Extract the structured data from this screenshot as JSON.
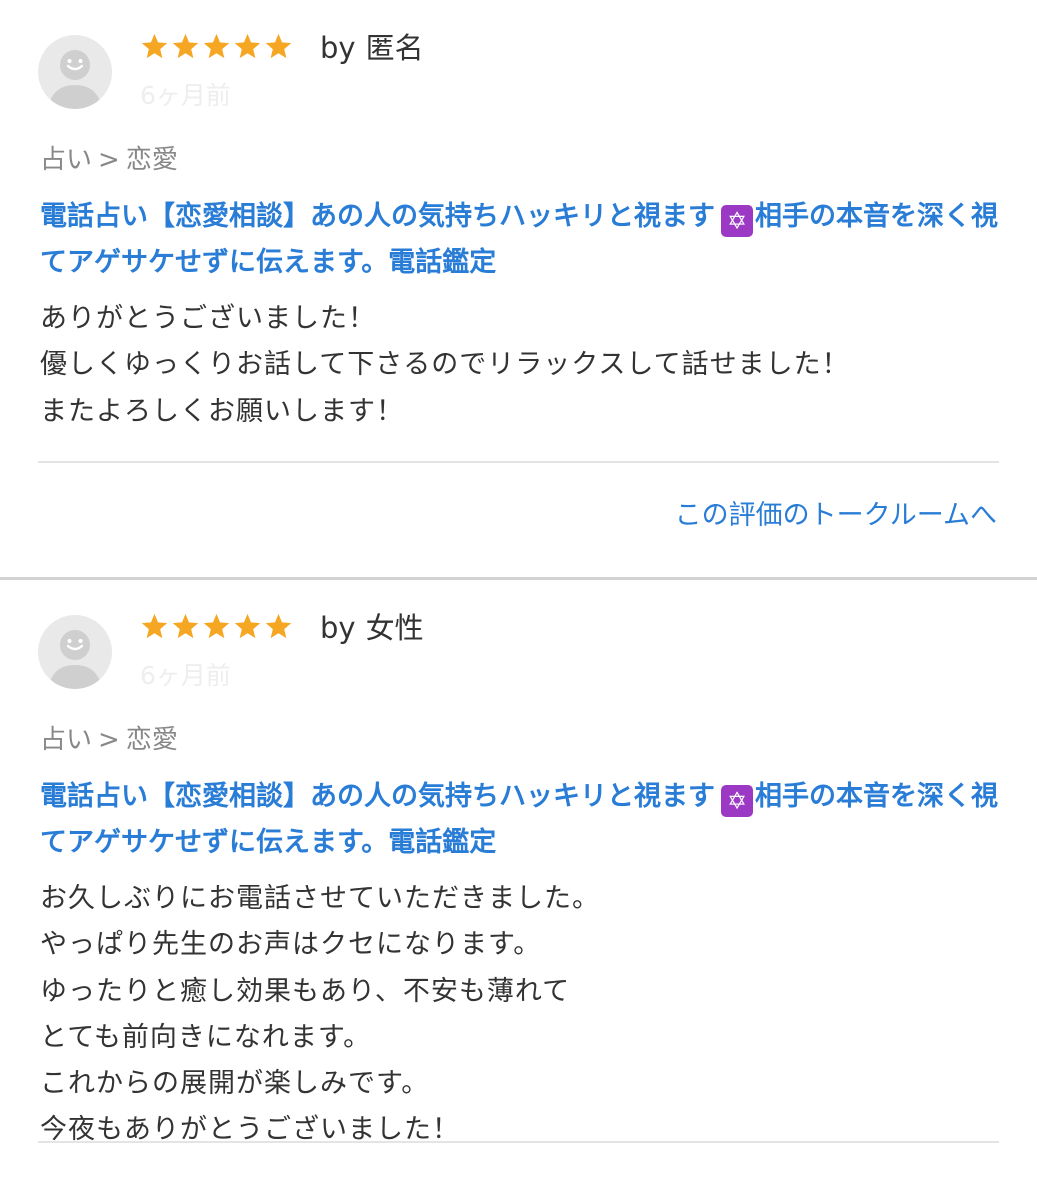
{
  "colors": {
    "link": "#2a7dd6",
    "star": "#f5a623",
    "emoji_bg": "#9b39c4",
    "muted": "#888888"
  },
  "reviews": [
    {
      "rating": 5,
      "by_label": "by",
      "author": "匿名",
      "date": "6ヶ月前",
      "category": {
        "parent": "占い",
        "separator": ">",
        "child": "恋愛"
      },
      "service_title": {
        "before_emoji": "電話占い【恋愛相談】あの人の気持ちハッキリと視ます",
        "emoji": "✡",
        "after_emoji": "相手の本音を深く視てアゲサケせずに伝えます。電話鑑定"
      },
      "body_lines": [
        "ありがとうございました！",
        "優しくゆっくりお話して下さるのでリラックスして話せました！",
        "またよろしくお願いします！"
      ],
      "talk_link": "この評価のトークルームへ"
    },
    {
      "rating": 5,
      "by_label": "by",
      "author": "女性",
      "date": "6ヶ月前",
      "category": {
        "parent": "占い",
        "separator": ">",
        "child": "恋愛"
      },
      "service_title": {
        "before_emoji": "電話占い【恋愛相談】あの人の気持ちハッキリと視ます",
        "emoji": "✡",
        "after_emoji": "相手の本音を深く視てアゲサケせずに伝えます。電話鑑定"
      },
      "body_lines": [
        "お久しぶりにお電話させていただきました。",
        "やっぱり先生のお声はクセになります。",
        "ゆったりと癒し効果もあり、不安も薄れて",
        "とても前向きになれます。",
        "これからの展開が楽しみです。",
        "今夜もありがとうございました！"
      ]
    }
  ]
}
